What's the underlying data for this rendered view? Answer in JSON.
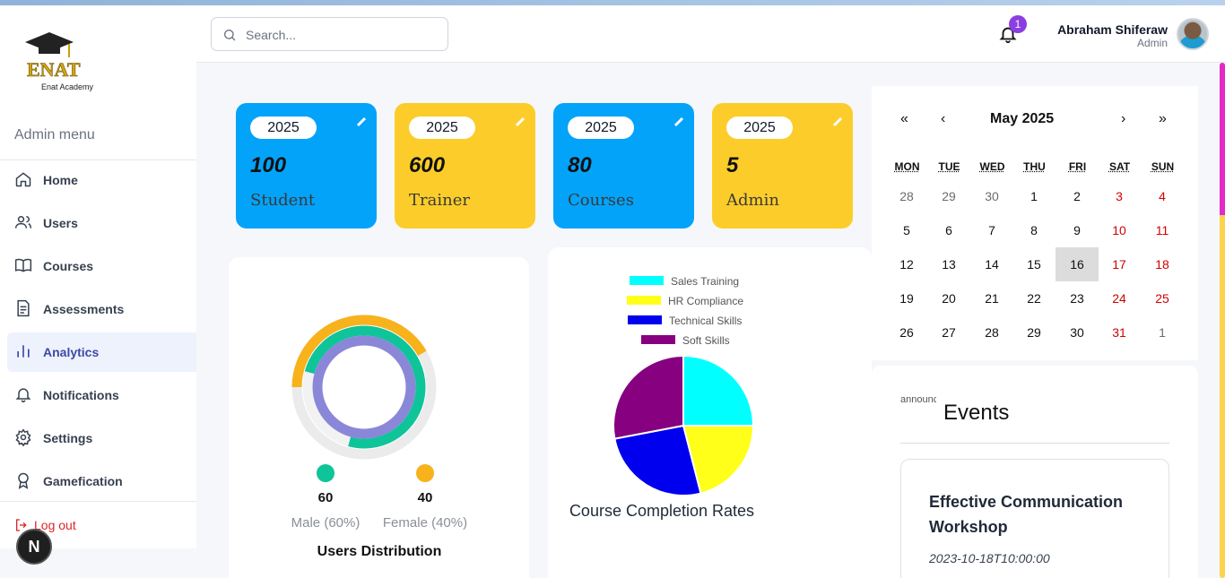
{
  "search": {
    "placeholder": "Search..."
  },
  "notifications": {
    "count": "1"
  },
  "user": {
    "name": "Abraham Shiferaw",
    "role": "Admin"
  },
  "logo": {
    "brand": "ENAT",
    "name": "Enat Academy"
  },
  "sidebar": {
    "heading": "Admin menu",
    "items": [
      {
        "label": "Home",
        "icon": "home-icon"
      },
      {
        "label": "Users",
        "icon": "users-icon"
      },
      {
        "label": "Courses",
        "icon": "book-icon"
      },
      {
        "label": "Assessments",
        "icon": "document-icon"
      },
      {
        "label": "Analytics",
        "icon": "bar-chart-icon",
        "active": true
      },
      {
        "label": "Notifications",
        "icon": "bell-icon"
      },
      {
        "label": "Settings",
        "icon": "gear-icon"
      },
      {
        "label": "Gamefication",
        "icon": "award-icon"
      }
    ],
    "logout": "Log out",
    "dev_badge": "N"
  },
  "stats": [
    {
      "year": "2025",
      "value": "100",
      "label": "Student",
      "color": "#03a3fa"
    },
    {
      "year": "2025",
      "value": "600",
      "label": "Trainer",
      "color": "#fccd2a"
    },
    {
      "year": "2025",
      "value": "80",
      "label": "Courses",
      "color": "#03a3fa"
    },
    {
      "year": "2025",
      "value": "5",
      "label": "Admin",
      "color": "#fccd2a"
    }
  ],
  "users_distribution": {
    "title": "Users Distribution",
    "male": {
      "count": "60",
      "label": "Male (60%)",
      "color": "#10c49a"
    },
    "female": {
      "count": "40",
      "label": "Female (40%)",
      "color": "#f7b21c"
    }
  },
  "chart_data": {
    "type": "pie",
    "title": "Course Completion Rates",
    "legend_position": "top",
    "series": [
      {
        "name": "Sales Training",
        "value": 25,
        "color": "#00ffff"
      },
      {
        "name": "HR Compliance",
        "value": 21,
        "color": "#ffff1a"
      },
      {
        "name": "Technical Skills",
        "value": 26,
        "color": "#0000ee"
      },
      {
        "name": "Soft Skills",
        "value": 28,
        "color": "#860080"
      }
    ]
  },
  "calendar": {
    "month_label": "May 2025",
    "nav": {
      "prev_year": "«",
      "prev_month": "‹",
      "next_month": "›",
      "next_year": "»"
    },
    "weekdays": [
      "MON",
      "TUE",
      "WED",
      "THU",
      "FRI",
      "SAT",
      "SUN"
    ],
    "weeks": [
      [
        "28",
        "29",
        "30",
        "1",
        "2",
        "3",
        "4"
      ],
      [
        "5",
        "6",
        "7",
        "8",
        "9",
        "10",
        "11"
      ],
      [
        "12",
        "13",
        "14",
        "15",
        "16",
        "17",
        "18"
      ],
      [
        "19",
        "20",
        "21",
        "22",
        "23",
        "24",
        "25"
      ],
      [
        "26",
        "27",
        "28",
        "29",
        "30",
        "31",
        "1"
      ]
    ],
    "today": "16"
  },
  "events": {
    "title": "Events",
    "image_alt": "announcement",
    "items": [
      {
        "name": "Effective Communication Workshop",
        "date": "2023-10-18T10:00:00"
      }
    ]
  }
}
